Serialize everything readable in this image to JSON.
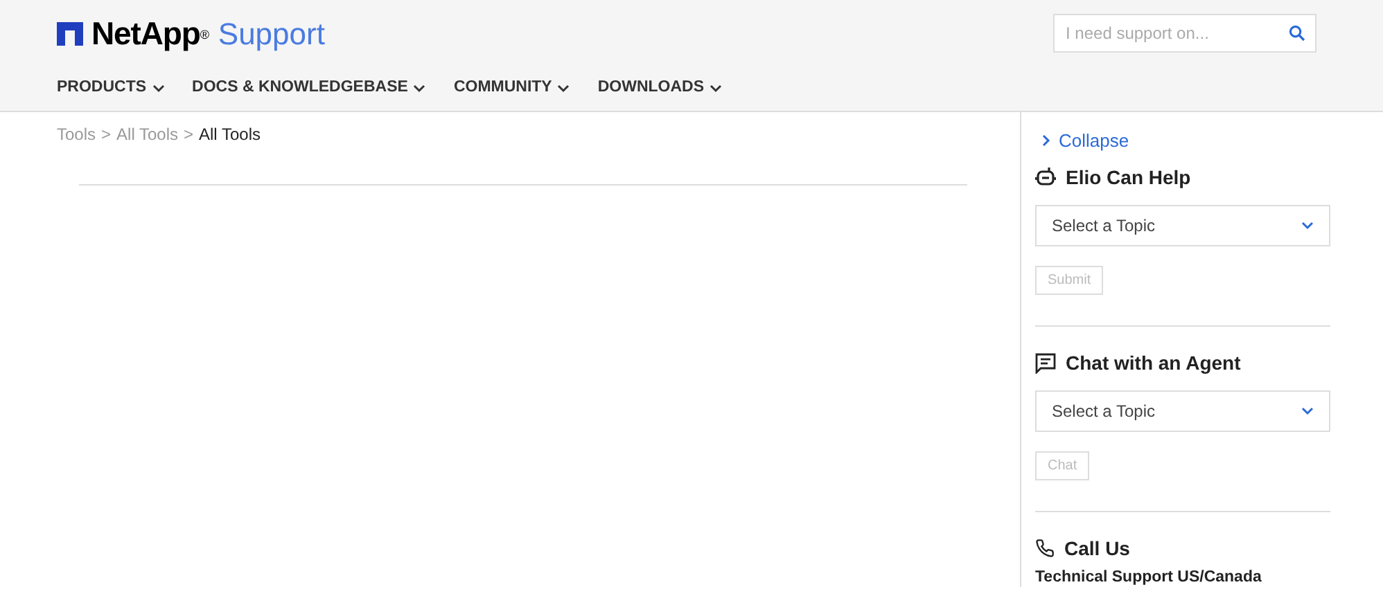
{
  "header": {
    "logo": "NetApp",
    "logo_mark": "®",
    "product": "Support",
    "search": {
      "placeholder": "I need support on..."
    }
  },
  "nav": [
    {
      "label": "PRODUCTS"
    },
    {
      "label": "DOCS & KNOWLEDGEBASE"
    },
    {
      "label": "COMMUNITY"
    },
    {
      "label": "DOWNLOADS"
    }
  ],
  "breadcrumb": {
    "separator": ">",
    "items": [
      {
        "label": "Tools",
        "current": false
      },
      {
        "label": "All Tools",
        "current": false
      },
      {
        "label": "All Tools",
        "current": true
      }
    ]
  },
  "sidebar": {
    "collapse": "Collapse",
    "sections": [
      {
        "kind": "bot",
        "title": "Elio Can Help",
        "select": "Select a Topic",
        "button": {
          "label": "Submit",
          "disabled": true
        }
      },
      {
        "kind": "chat",
        "title": "Chat with an Agent",
        "select": "Select a Topic",
        "button": {
          "label": "Chat",
          "disabled": true
        }
      },
      {
        "kind": "phone",
        "title": "Call Us",
        "subtitle": "Technical Support US/Canada"
      }
    ]
  }
}
